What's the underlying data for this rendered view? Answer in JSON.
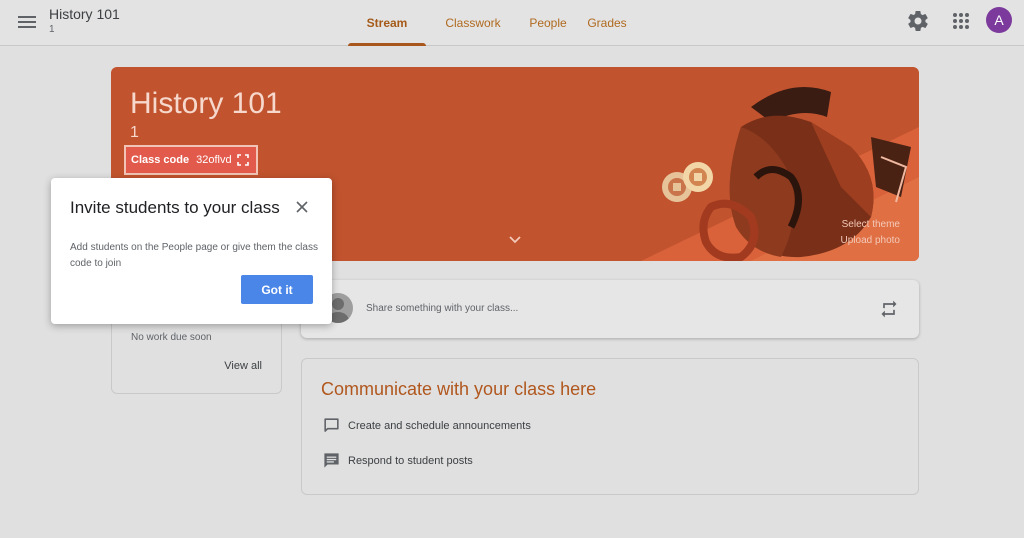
{
  "header": {
    "title": "History 101",
    "subtitle": "1",
    "tabs": [
      {
        "label": "Stream",
        "active": true
      },
      {
        "label": "Classwork"
      },
      {
        "label": "People"
      },
      {
        "label": "Grades"
      }
    ],
    "avatar_letter": "A",
    "avatar_color": "#7b3a9c",
    "icons": [
      "menu-icon",
      "gear-icon",
      "apps-grid-icon"
    ]
  },
  "banner": {
    "title": "History 101",
    "subtitle": "1",
    "class_code_label": "Class code",
    "class_code_value": "32oflvd",
    "select_theme": "Select theme",
    "upload_photo": "Upload photo",
    "background_color": "#c1532e"
  },
  "upcoming": {
    "no_work": "No work due soon",
    "view_all": "View all"
  },
  "share": {
    "placeholder": "Share something with your class..."
  },
  "communicate": {
    "title": "Communicate with your class here",
    "items": [
      {
        "icon": "chat-bubble-icon",
        "label": "Create and schedule announcements"
      },
      {
        "icon": "comment-icon",
        "label": "Respond to student posts"
      }
    ]
  },
  "dialog": {
    "title": "Invite students to your class",
    "body": "Add students on the People page or give them the class code to join",
    "button": "Got it"
  }
}
